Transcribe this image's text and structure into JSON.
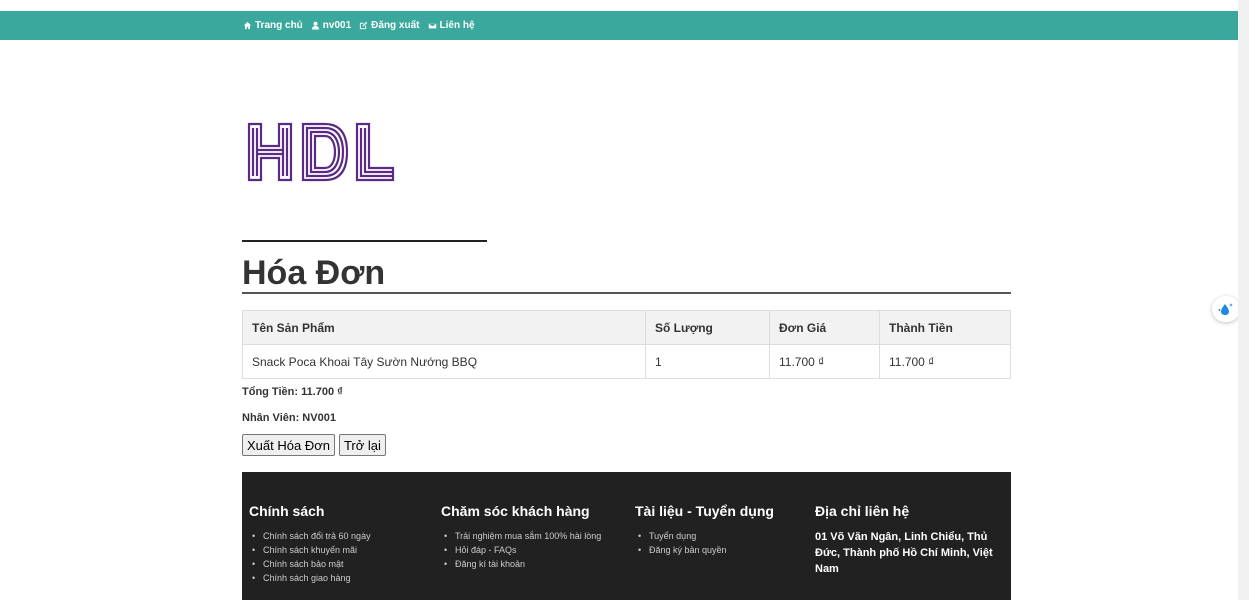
{
  "nav": {
    "home": "Trang chủ",
    "user": "nv001",
    "logout": "Đăng xuất",
    "contact": "Liên hệ"
  },
  "logo": {
    "text": "HDL",
    "color": "#5b2a86"
  },
  "page": {
    "title": "Hóa Đơn"
  },
  "table": {
    "headers": [
      "Tên Sản Phẩm",
      "Số Lượng",
      "Đơn Giá",
      "Thành Tiền"
    ],
    "rows": [
      [
        "Snack Poca Khoai Tây Sườn Nướng BBQ",
        "1",
        "11.700 ₫",
        "11.700 ₫"
      ]
    ]
  },
  "summary": {
    "total": "Tổng Tiền: 11.700 ₫",
    "staff": "Nhân Viên: NV001"
  },
  "buttons": {
    "export": "Xuất Hóa Đơn",
    "back": "Trở lại"
  },
  "footer": {
    "policy": {
      "title": "Chính sách",
      "items": [
        "Chính sách đổi trả 60 ngày",
        "Chính sách khuyến mãi",
        "Chính sách bảo mật",
        "Chính sách giao hàng"
      ]
    },
    "care": {
      "title": "Chăm sóc khách hàng",
      "items": [
        "Trải nghiệm mua sắm 100% hài lòng",
        "Hỏi đáp - FAQs",
        "Đăng kí tài khoản"
      ]
    },
    "docs": {
      "title": "Tài liệu - Tuyển dụng",
      "items": [
        "Tuyển dụng",
        "Đăng ký bản quyền"
      ]
    },
    "address": {
      "title": "Địa chỉ liên hệ",
      "text": "01 Võ Văn Ngân, Linh Chiểu, Thủ Đức, Thành phố Hồ Chí Minh, Việt Nam"
    }
  },
  "colors": {
    "topbar": "#3aa89c",
    "footer": "#212121"
  }
}
